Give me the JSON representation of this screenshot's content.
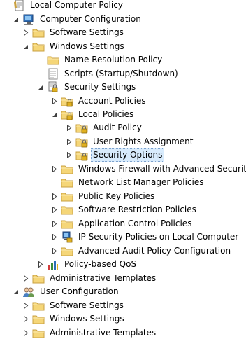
{
  "tree": {
    "nodes": [
      {
        "label": "Local Computer Policy",
        "icon": "policy-document-icon",
        "arrow": "none"
      },
      {
        "label": "Computer Configuration",
        "icon": "computer-icon",
        "arrow": "expanded"
      },
      {
        "label": "Software Settings",
        "icon": "folder-icon",
        "arrow": "collapsed"
      },
      {
        "label": "Windows Settings",
        "icon": "folder-icon",
        "arrow": "expanded"
      },
      {
        "label": "Name Resolution Policy",
        "icon": "folder-icon",
        "arrow": "none"
      },
      {
        "label": "Scripts (Startup/Shutdown)",
        "icon": "script-icon",
        "arrow": "none"
      },
      {
        "label": "Security Settings",
        "icon": "security-settings-icon",
        "arrow": "expanded"
      },
      {
        "label": "Account Policies",
        "icon": "locked-folder-icon",
        "arrow": "collapsed"
      },
      {
        "label": "Local Policies",
        "icon": "locked-folder-icon",
        "arrow": "expanded"
      },
      {
        "label": "Audit Policy",
        "icon": "locked-folder-icon",
        "arrow": "collapsed"
      },
      {
        "label": "User Rights Assignment",
        "icon": "locked-folder-icon",
        "arrow": "collapsed"
      },
      {
        "label": "Security Options",
        "icon": "locked-folder-icon",
        "arrow": "collapsed",
        "selected": true
      },
      {
        "label": "Windows Firewall with Advanced Security",
        "icon": "folder-icon",
        "arrow": "collapsed"
      },
      {
        "label": "Network List Manager Policies",
        "icon": "folder-icon",
        "arrow": "none"
      },
      {
        "label": "Public Key Policies",
        "icon": "folder-icon",
        "arrow": "collapsed"
      },
      {
        "label": "Software Restriction Policies",
        "icon": "folder-icon",
        "arrow": "collapsed"
      },
      {
        "label": "Application Control Policies",
        "icon": "folder-icon",
        "arrow": "collapsed"
      },
      {
        "label": "IP Security Policies on Local Computer",
        "icon": "ip-security-icon",
        "arrow": "collapsed"
      },
      {
        "label": "Advanced Audit Policy Configuration",
        "icon": "folder-icon",
        "arrow": "collapsed"
      },
      {
        "label": "Policy-based QoS",
        "icon": "qos-chart-icon",
        "arrow": "collapsed"
      },
      {
        "label": "Administrative Templates",
        "icon": "folder-icon",
        "arrow": "collapsed"
      },
      {
        "label": "User Configuration",
        "icon": "users-icon",
        "arrow": "expanded"
      },
      {
        "label": "Software Settings",
        "icon": "folder-icon",
        "arrow": "collapsed"
      },
      {
        "label": "Windows Settings",
        "icon": "folder-icon",
        "arrow": "collapsed"
      },
      {
        "label": "Administrative Templates",
        "icon": "folder-icon",
        "arrow": "collapsed"
      }
    ]
  },
  "colors": {
    "folder": "#f5d678",
    "folder_edge": "#c9a040",
    "selection": "#d8ebfc",
    "selection_border": "#7da2ce",
    "arrow": "#404040"
  }
}
